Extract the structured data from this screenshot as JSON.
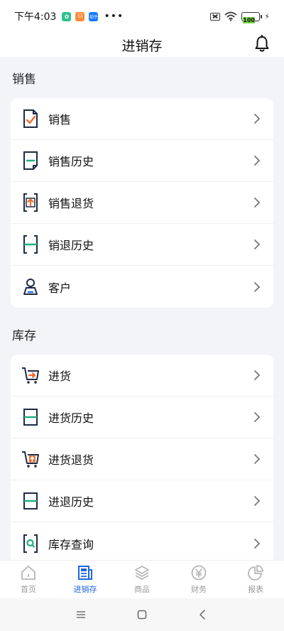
{
  "status": {
    "time": "下午4:03",
    "badge1": "✿",
    "badge2": "ᘏ",
    "badge3": "知乎",
    "dots": "•••",
    "battery": "100",
    "bolt": "⚡"
  },
  "header": {
    "title": "进销存"
  },
  "sections": [
    {
      "title": "销售",
      "items": [
        {
          "label": "销售",
          "icon": "sales-check-icon"
        },
        {
          "label": "销售历史",
          "icon": "sales-history-icon"
        },
        {
          "label": "销售退货",
          "icon": "sales-return-icon"
        },
        {
          "label": "销退历史",
          "icon": "sales-return-history-icon"
        },
        {
          "label": "客户",
          "icon": "customer-icon"
        }
      ]
    },
    {
      "title": "库存",
      "items": [
        {
          "label": "进货",
          "icon": "cart-in-icon"
        },
        {
          "label": "进货历史",
          "icon": "purchase-history-icon"
        },
        {
          "label": "进货退货",
          "icon": "cart-return-icon"
        },
        {
          "label": "进退历史",
          "icon": "purchase-return-history-icon"
        },
        {
          "label": "库存查询",
          "icon": "inventory-search-icon"
        }
      ]
    }
  ],
  "tabs": [
    {
      "label": "首页",
      "icon": "home-icon",
      "active": false
    },
    {
      "label": "进销存",
      "icon": "document-icon",
      "active": true
    },
    {
      "label": "商品",
      "icon": "layers-icon",
      "active": false
    },
    {
      "label": "财务",
      "icon": "yen-icon",
      "active": false
    },
    {
      "label": "报表",
      "icon": "pie-chart-icon",
      "active": false
    }
  ],
  "colors": {
    "accent": "#1e66e0",
    "orange": "#f06b2a",
    "green": "#22b07d",
    "navy": "#1f2a44"
  }
}
